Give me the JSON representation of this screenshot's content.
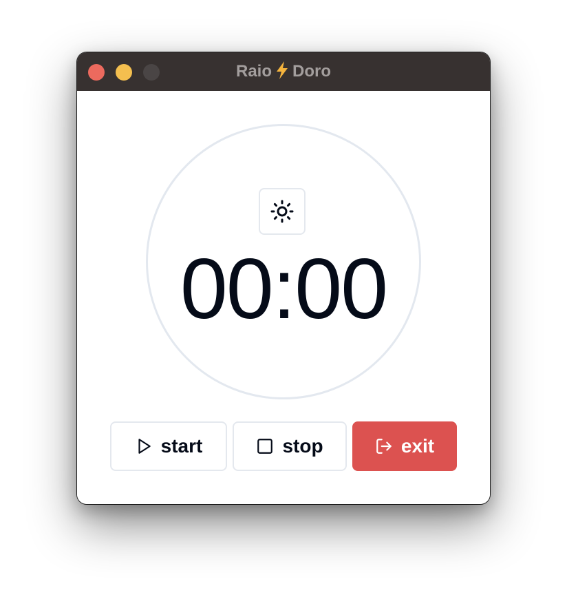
{
  "window": {
    "title_left": "Raio",
    "title_right": "Doro",
    "title_icon": "lightning-bolt-icon",
    "traffic_lights": {
      "close_color": "#ec6a5e",
      "minimize_color": "#f4bf4f",
      "zoom_color": "#4a4545"
    }
  },
  "timer": {
    "display": "00:00",
    "theme_icon": "sun-icon"
  },
  "buttons": {
    "start_label": "start",
    "start_icon": "play-icon",
    "stop_label": "stop",
    "stop_icon": "square-icon",
    "exit_label": "exit",
    "exit_icon": "log-out-icon",
    "exit_color": "#dc5250"
  },
  "colors": {
    "titlebar": "#373130",
    "ring": "#e3e8ef",
    "text": "#050b18"
  }
}
